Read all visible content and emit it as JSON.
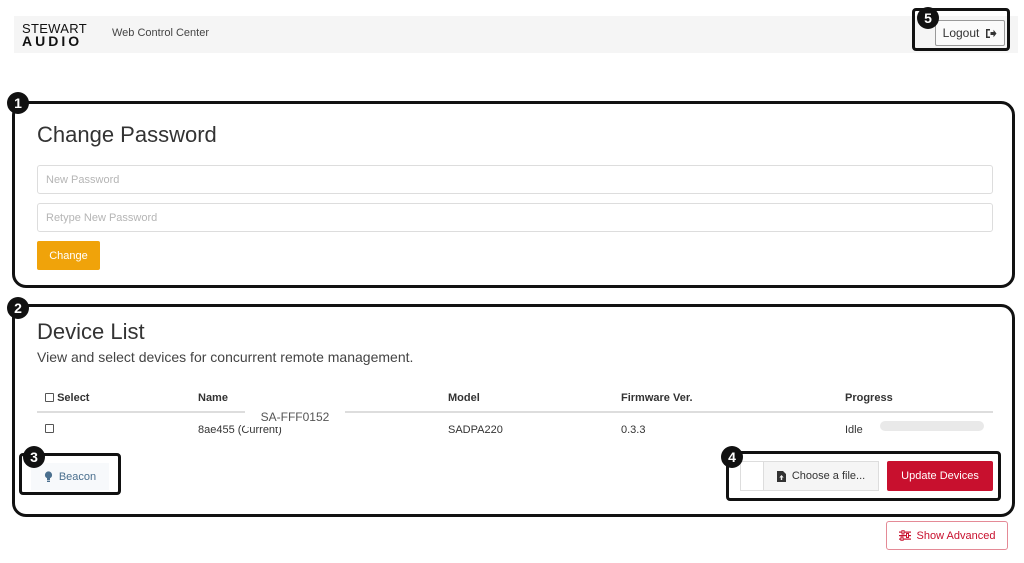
{
  "header": {
    "logo_top": "STEWART",
    "logo_bottom": "AUDIO",
    "app_title": "Web Control Center",
    "logout_label": "Logout"
  },
  "callouts": [
    "1",
    "2",
    "3",
    "4",
    "5"
  ],
  "password": {
    "title": "Change Password",
    "new_placeholder": "New Password",
    "retype_placeholder": "Retype New Password",
    "change_label": "Change"
  },
  "devices": {
    "title": "Device List",
    "subtitle": "View and select devices for concurrent remote management.",
    "columns": {
      "select": "Select",
      "name": "Name",
      "model": "Model",
      "firmware": "Firmware Ver.",
      "progress": "Progress"
    },
    "rows": [
      {
        "name": "8ae455 (Current)",
        "model": "SADPA220",
        "firmware": "0.3.3",
        "status": "Idle",
        "progress": 0
      }
    ],
    "tooltip": "SA-FFF0152",
    "beacon_label": "Beacon",
    "choose_file_label": "Choose a file...",
    "update_label": "Update Devices"
  },
  "advanced_label": "Show Advanced",
  "colors": {
    "accent_orange": "#f0a30a",
    "accent_red": "#c8102e",
    "beacon_blue": "#4a6f8e"
  },
  "icons": [
    "logout-icon",
    "lightbulb-icon",
    "file-upload-icon",
    "sliders-icon"
  ]
}
